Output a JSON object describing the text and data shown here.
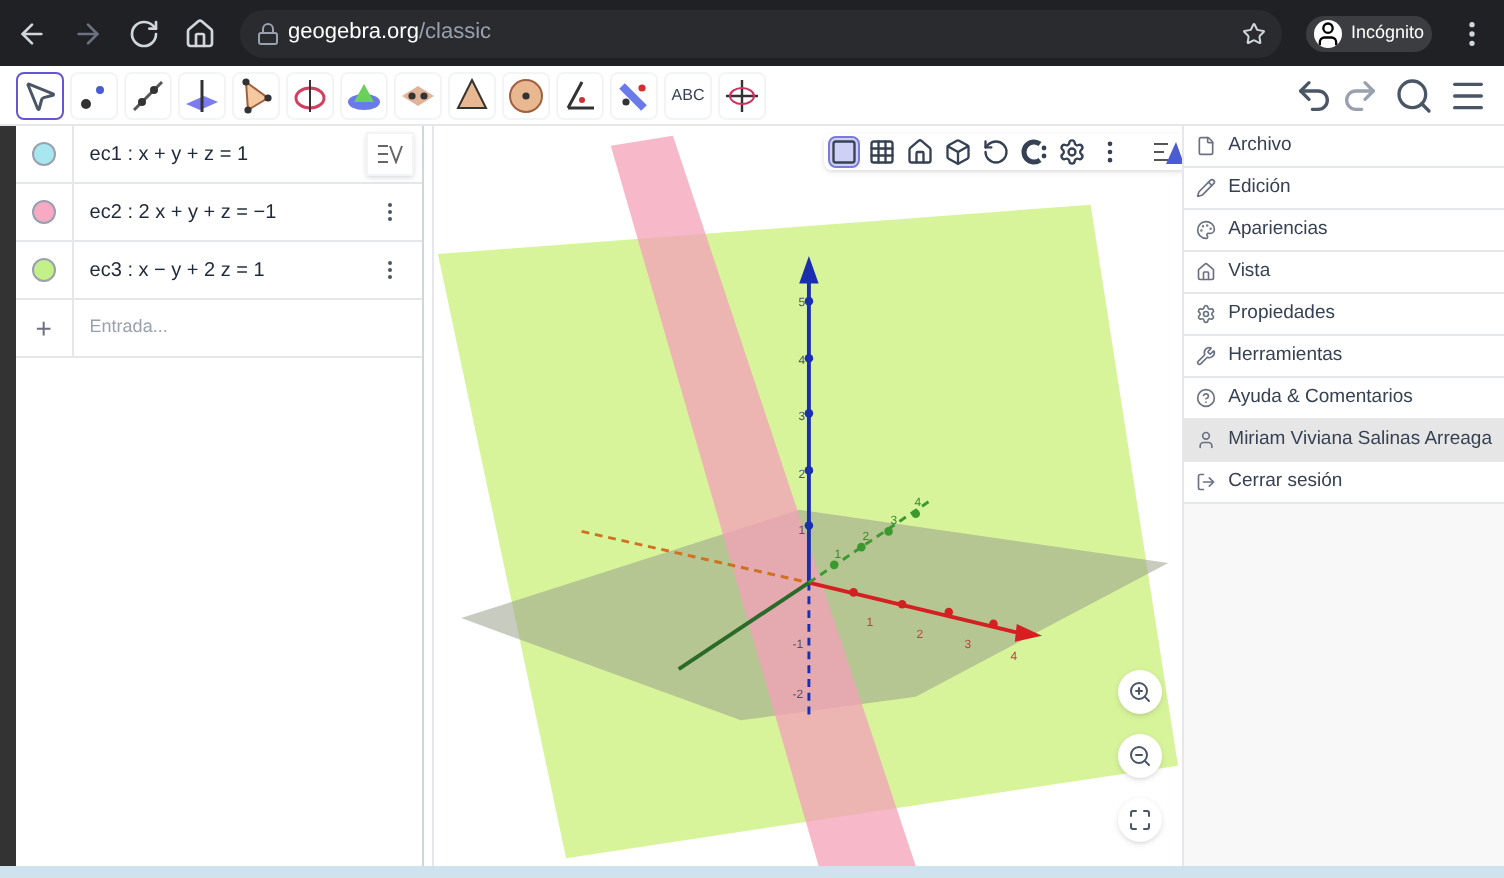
{
  "browser": {
    "url_host": "geogebra.org",
    "url_path": "/classic",
    "profile": "Incógnito"
  },
  "toolbar": {
    "tools": [
      {
        "kind": "move",
        "selected": true
      },
      {
        "kind": "point",
        "selected": false
      },
      {
        "kind": "line",
        "selected": false
      },
      {
        "kind": "perpendicular",
        "selected": false
      },
      {
        "kind": "polygon",
        "selected": false
      },
      {
        "kind": "circle-axis",
        "selected": false
      },
      {
        "kind": "intersect",
        "selected": false
      },
      {
        "kind": "plane",
        "selected": false
      },
      {
        "kind": "pyramid",
        "selected": false
      },
      {
        "kind": "sphere",
        "selected": false
      },
      {
        "kind": "angle",
        "selected": false
      },
      {
        "kind": "reflect",
        "selected": false
      },
      {
        "kind": "text",
        "label": "ABC",
        "selected": false
      },
      {
        "kind": "rotate-view",
        "selected": false
      }
    ]
  },
  "algebra": {
    "rows": [
      {
        "text": "ec1 : x + y + z = 1",
        "color": "#a8e6f0",
        "kind": "style"
      },
      {
        "text": "ec2 : 2 x + y + z = −1",
        "color": "#f8a9c4",
        "kind": "dots"
      },
      {
        "text": "ec3 : x − y + 2 z = 1",
        "color": "#c4f08a",
        "kind": "dots"
      }
    ],
    "input": {
      "icon": "+",
      "placeholder": "Entrada..."
    }
  },
  "graphics": {
    "toolbar": [
      {
        "kind": "axes",
        "selected": true
      },
      {
        "kind": "grid",
        "selected": false
      },
      {
        "kind": "home",
        "selected": false
      },
      {
        "kind": "cube",
        "selected": false
      },
      {
        "kind": "rotate",
        "selected": false
      },
      {
        "kind": "clipping",
        "selected": false
      },
      {
        "kind": "settings",
        "selected": false
      },
      {
        "kind": "more",
        "selected": false
      }
    ],
    "z_labels": [
      "5",
      "4",
      "3",
      "2",
      "1",
      "-1",
      "-2"
    ],
    "x_labels": [
      "1",
      "2",
      "3",
      "4"
    ],
    "y_labels": [
      "1",
      "2",
      "3",
      "4"
    ]
  },
  "menu": {
    "items": [
      {
        "label": "Archivo",
        "selected": false
      },
      {
        "label": "Edición",
        "selected": false
      },
      {
        "label": "Apariencias",
        "selected": false
      },
      {
        "label": "Vista",
        "selected": false
      },
      {
        "label": "Propiedades",
        "selected": false
      },
      {
        "label": "Herramientas",
        "selected": false
      },
      {
        "label": "Ayuda & Comentarios",
        "selected": false
      },
      {
        "label": "Miriam Viviana Salinas Arreaga",
        "selected": true
      },
      {
        "label": "Cerrar sesión",
        "selected": false
      }
    ]
  }
}
